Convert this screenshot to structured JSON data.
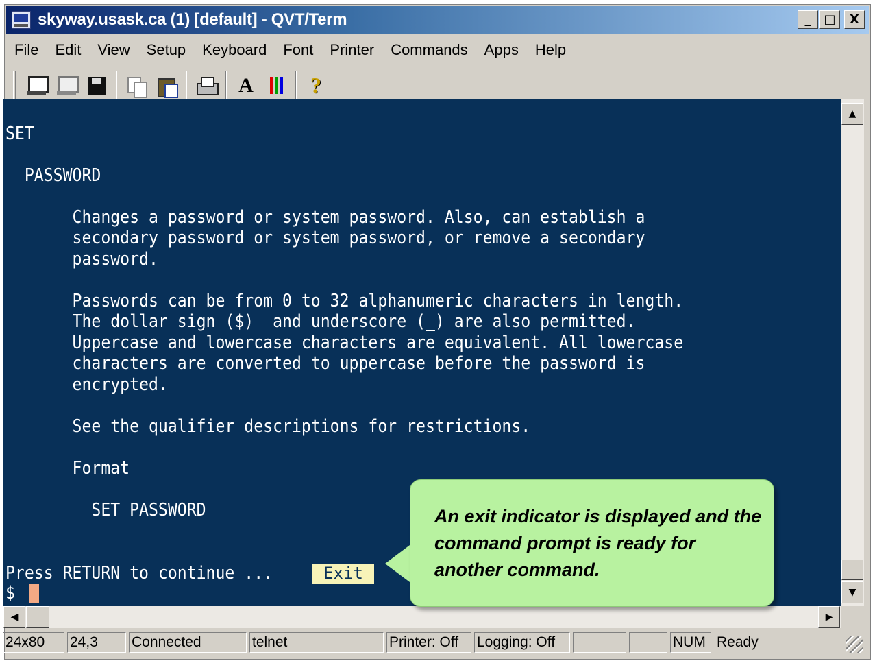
{
  "window": {
    "title": "skyway.usask.ca (1) [default] - QVT/Term",
    "minimize_glyph": "_",
    "maximize_glyph": "□",
    "close_glyph": "X"
  },
  "menu": [
    "File",
    "Edit",
    "View",
    "Setup",
    "Keyboard",
    "Font",
    "Printer",
    "Commands",
    "Apps",
    "Help"
  ],
  "toolbar": {
    "icons": [
      "connect-icon",
      "disconnect-icon",
      "save-icon",
      "copy-icon",
      "paste-icon",
      "print-icon",
      "font-icon",
      "colors-icon",
      "help-icon"
    ],
    "font_glyph": "A",
    "help_glyph": "?",
    "color_bars": [
      "#e00000",
      "#00a000",
      "#0000e0"
    ]
  },
  "terminal": {
    "background": "#083058",
    "lines": [
      "SET",
      "  PASSWORD",
      "       Changes a password or system password. Also, can establish a",
      "       secondary password or system password, or remove a secondary",
      "       password.",
      "       Passwords can be from 0 to 32 alphanumeric characters in length.",
      "       The dollar sign ($)  and underscore (_) are also permitted.",
      "       Uppercase and lowercase characters are equivalent. All lowercase",
      "       characters are converted to uppercase before the password is",
      "       encrypted.",
      "       See the qualifier descriptions for restrictions.",
      "       Format",
      "         SET PASSWORD",
      "Press RETURN to continue ...",
      "$"
    ],
    "exit_indicator": "Exit"
  },
  "scrollbar": {
    "up": "▲",
    "down": "▼",
    "left": "◀",
    "right": "▶"
  },
  "status": {
    "size": "24x80",
    "cursor": "24,3",
    "connection": "Connected",
    "protocol": "telnet",
    "printer": "Printer: Off",
    "logging": "Logging: Off",
    "num": "NUM",
    "state": "Ready"
  },
  "callout": {
    "text": "An exit indicator is displayed and the command prompt is ready for another command.",
    "color": "#b8f2a0"
  }
}
